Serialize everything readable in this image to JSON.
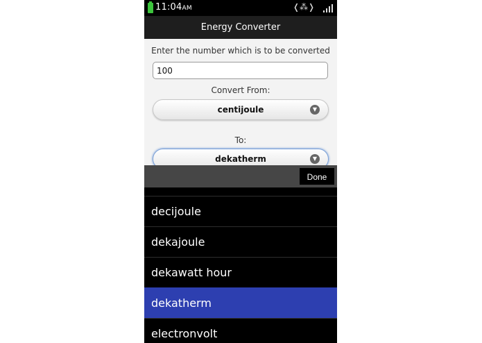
{
  "status": {
    "time": "11:04",
    "ampm": "AM",
    "battery_color": "#3cc43c",
    "icons": [
      "battery-icon",
      "vibrate-icon",
      "signal-icon"
    ]
  },
  "app": {
    "title": "Energy Converter"
  },
  "form": {
    "prompt": "Enter the number which is to be converted",
    "number_value": "100",
    "from_label": "Convert From:",
    "from_value": "centijoule",
    "to_label": "To:",
    "to_value": "dekatherm"
  },
  "picker": {
    "done_label": "Done",
    "selected_color": "#2d3fb0",
    "items": [
      "decijoule",
      "dekajoule",
      "dekawatt hour",
      "dekatherm",
      "electronvolt"
    ],
    "selected_index": 3
  }
}
